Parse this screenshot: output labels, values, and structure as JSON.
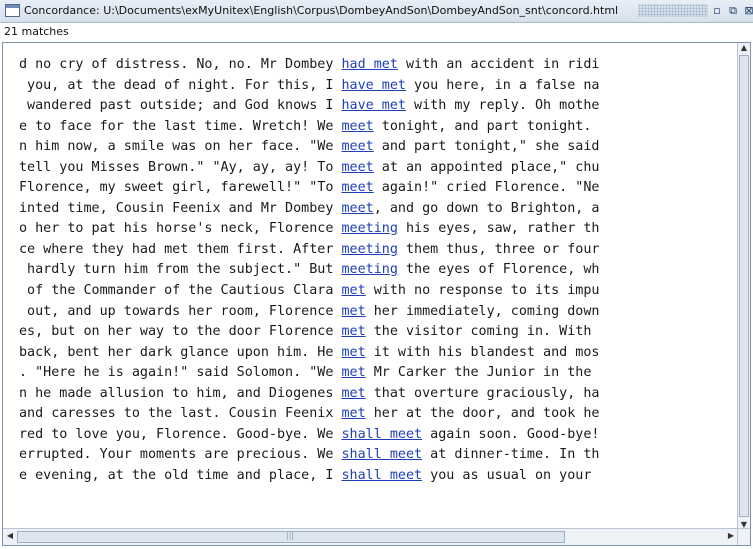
{
  "window": {
    "title": "Concordance: U:\\Documents\\exMyUnitex\\English\\Corpus\\DombeyAndSon\\DombeyAndSon_snt\\concord.html",
    "min_label": "▫",
    "max_label": "⧉",
    "close_label": "⊠"
  },
  "status": {
    "matches": "21 matches"
  },
  "concordance": {
    "rows": [
      {
        "left": "d no cry of distress. No, no. Mr Dombey ",
        "match": "had met",
        "right": " with an accident in ridi"
      },
      {
        "left": " you, at the dead of night. For this, I ",
        "match": "have met",
        "right": " you here, in a false na"
      },
      {
        "left": " wandered past outside; and God knows I ",
        "match": "have met",
        "right": " with my reply. Oh mothe"
      },
      {
        "left": "e to face for the last time. Wretch! We ",
        "match": "meet",
        "right": " tonight, and part tonight."
      },
      {
        "left": "n him now, a smile was on her face. \"We ",
        "match": "meet",
        "right": " and part tonight,\" she said"
      },
      {
        "left": "tell you Misses Brown.\" \"Ay, ay, ay! To ",
        "match": "meet",
        "right": " at an appointed place,\" chu"
      },
      {
        "left": "Florence, my sweet girl, farewell!\" \"To ",
        "match": "meet",
        "right": " again!\" cried Florence. \"Ne"
      },
      {
        "left": "inted time, Cousin Feenix and Mr Dombey ",
        "match": "meet",
        "right": ", and go down to Brighton, a"
      },
      {
        "left": "o her to pat his horse's neck, Florence ",
        "match": "meeting",
        "right": " his eyes, saw, rather th"
      },
      {
        "left": "ce where they had met them first. After ",
        "match": "meeting",
        "right": " them thus, three or four"
      },
      {
        "left": " hardly turn him from the subject.\" But ",
        "match": "meeting",
        "right": " the eyes of Florence, wh"
      },
      {
        "left": " of the Commander of the Cautious Clara ",
        "match": "met",
        "right": " with no response to its impu"
      },
      {
        "left": " out, and up towards her room, Florence ",
        "match": "met",
        "right": " her immediately, coming down"
      },
      {
        "left": "es, but on her way to the door Florence ",
        "match": "met",
        "right": " the visitor coming in. With"
      },
      {
        "left": "back, bent her dark glance upon him. He ",
        "match": "met",
        "right": " it with his blandest and mos"
      },
      {
        "left": ". \"Here he is again!\" said Solomon. \"We ",
        "match": "met",
        "right": " Mr Carker the Junior in the"
      },
      {
        "left": "n he made allusion to him, and Diogenes ",
        "match": "met",
        "right": " that overture graciously, ha"
      },
      {
        "left": "and caresses to the last. Cousin Feenix ",
        "match": "met",
        "right": " her at the door, and took he"
      },
      {
        "left": "red to love you, Florence. Good-bye. We ",
        "match": "shall meet",
        "right": " again soon. Good-bye!"
      },
      {
        "left": "errupted. Your moments are precious. We ",
        "match": "shall meet",
        "right": " at dinner-time. In th"
      },
      {
        "left": "e evening, at the old time and place, I ",
        "match": "shall meet",
        "right": " you as usual on your"
      }
    ]
  },
  "scrollbar": {
    "up_arrow": "▲",
    "down_arrow": "▼",
    "left_arrow": "◀",
    "right_arrow": "▶",
    "grip": "|||"
  },
  "colors": {
    "match_link": "#1f3fb8",
    "titlebar": "#dbe4ef"
  }
}
